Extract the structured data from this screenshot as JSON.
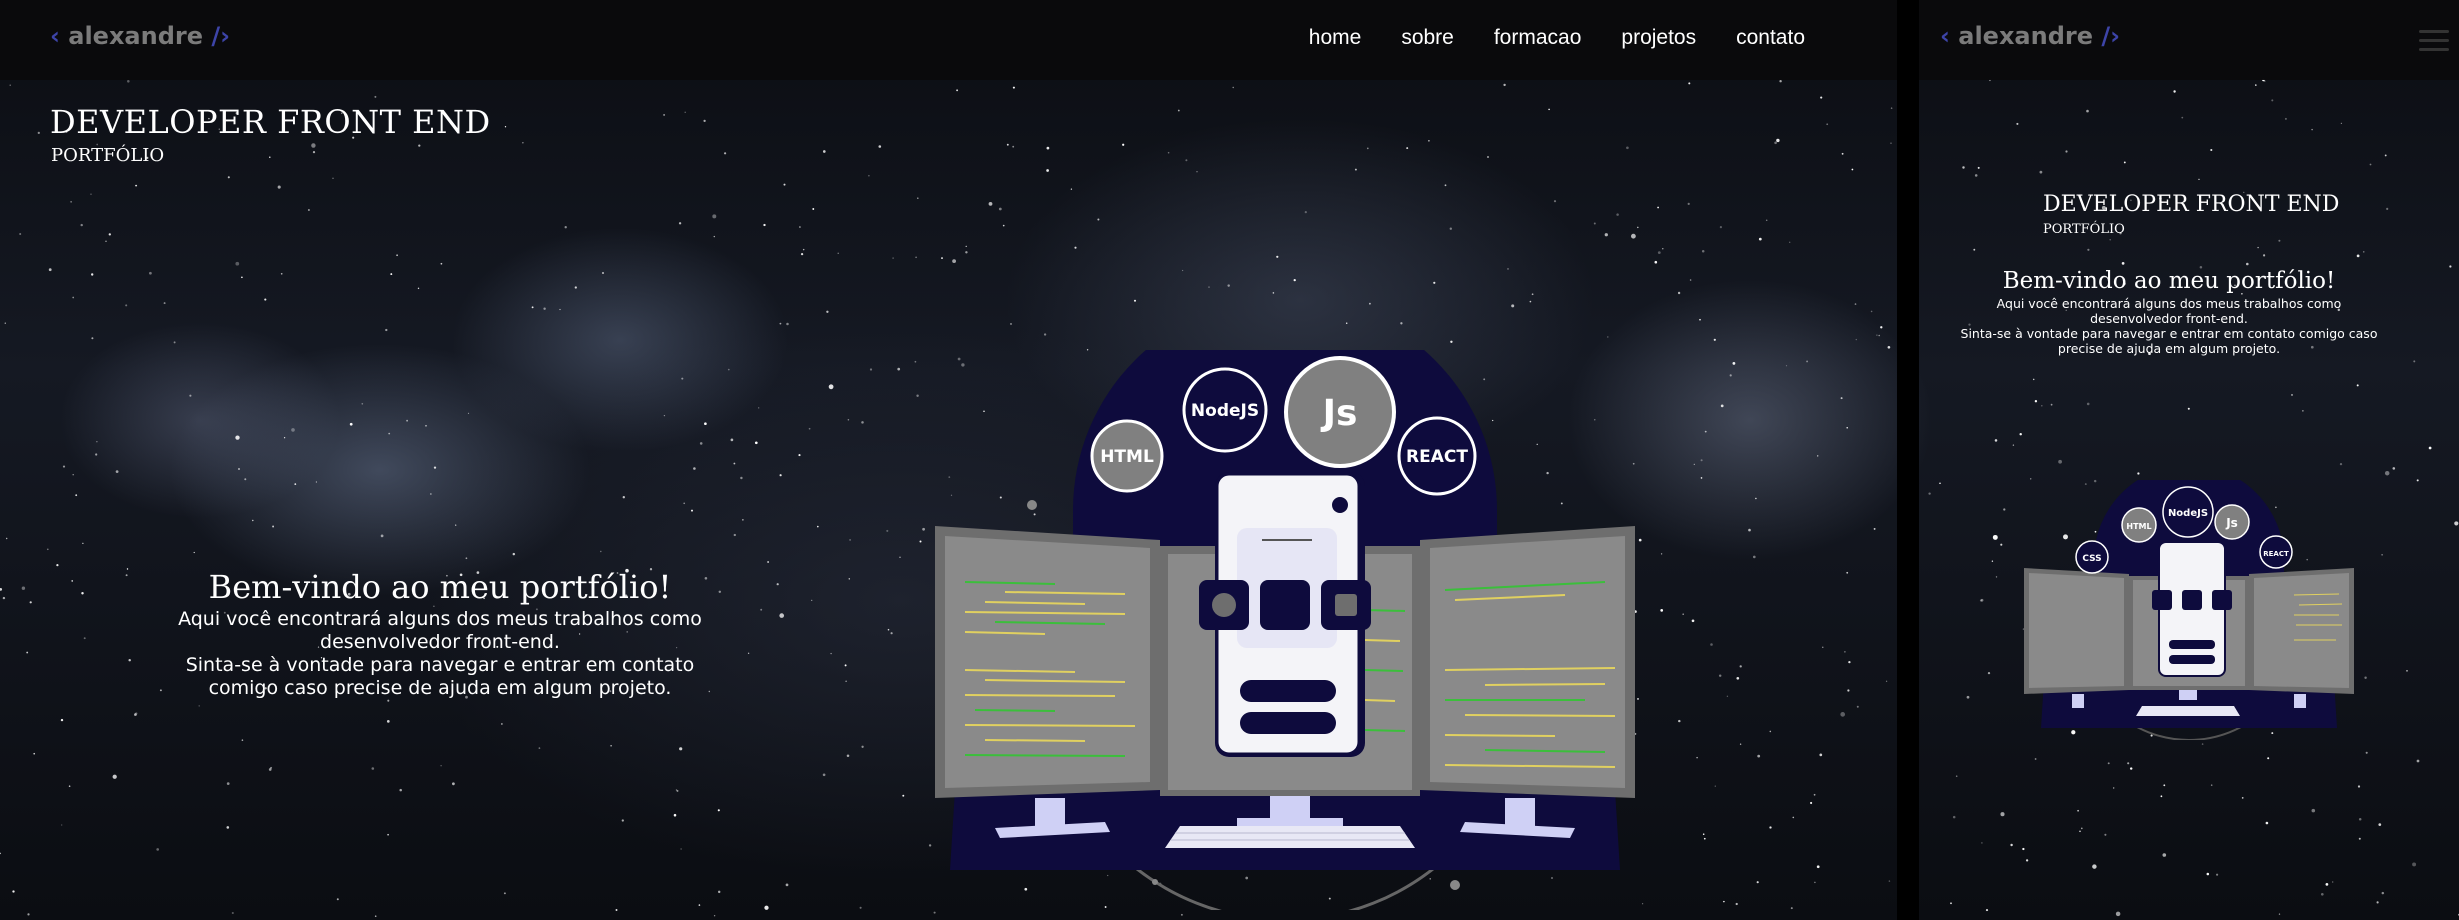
{
  "nav": {
    "logo": {
      "open": "‹",
      "name": "alexandre",
      "close": "/›"
    },
    "links": [
      "home",
      "sobre",
      "formacao",
      "projetos",
      "contato"
    ]
  },
  "hero": {
    "title": "DEVELOPER FRONT END",
    "subtitle": "PORTFÓLIO",
    "welcome_heading": "Bem-vindo ao meu portfólio!",
    "welcome_lines": [
      "Aqui você encontrará alguns dos meus trabalhos como",
      "desenvolvedor front-end.",
      "Sinta-se à vontade para navegar e entrar em contato",
      "comigo caso precise de ajuda em algum projeto."
    ]
  },
  "mobile": {
    "logo": {
      "open": "‹",
      "name": "alexandre",
      "close": "/›"
    },
    "menu_icon": "hamburger-menu-icon",
    "title": "DEVELOPER FRONT END",
    "subtitle": "PORTFÓLIO",
    "welcome_heading": "Bem-vindo ao meu portfólio!",
    "welcome_lines": [
      "Aqui você encontrará alguns dos meus trabalhos como",
      "desenvolvedor front-end.",
      "Sinta-se à vontade para navegar e entrar em contato comigo caso",
      "precise de ajuda em algum projeto."
    ]
  },
  "illustration": {
    "badges": [
      "HTML",
      "NodeJS",
      "Js",
      "REACT"
    ],
    "mobile_badges": [
      "CSS",
      "HTML",
      "NodeJS",
      "Js",
      "REACT"
    ]
  },
  "colors": {
    "background": "#000000",
    "navbar": "#0a0a0c",
    "logo_text": "#7b7b7b",
    "logo_bracket": "#3d44a8",
    "illustration_navy": "#0e0b3d",
    "monitor_gray": "#7e7e7e"
  }
}
